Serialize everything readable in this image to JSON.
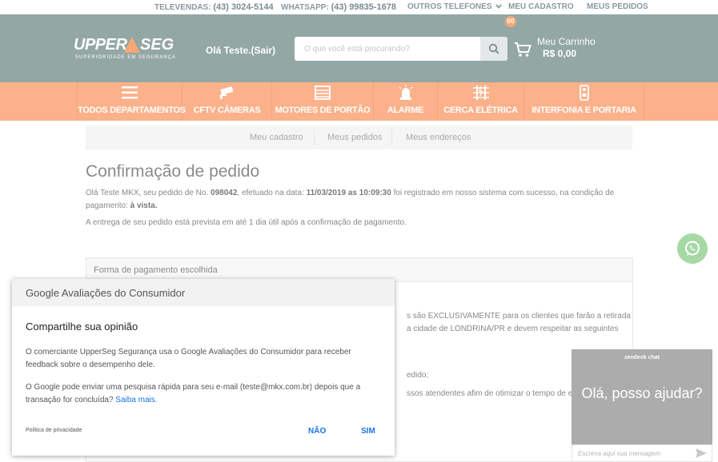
{
  "topbar": {
    "televendas_label": "TELEVENDAS:",
    "televendas_number": "(43) 3024-5144",
    "whatsapp_label": "WHATSAPP:",
    "whatsapp_number": "(43) 99835-1678",
    "outros_telefones": "OUTROS TELEFONES",
    "meu_cadastro": "MEU CADASTRO",
    "meus_pedidos": "MEUS PEDIDOS"
  },
  "header": {
    "logo_text_1": "UPPER",
    "logo_text_2": "SEG",
    "logo_subtitle": "SUPERIORIDADE EM SEGURANÇA",
    "greeting": "Olá Teste.(Sair)",
    "search_placeholder": "O que você está procurando?",
    "cart_title": "Meu Carrinho",
    "cart_value": "R$ 0,00",
    "cart_count": "00"
  },
  "nav": {
    "items": [
      {
        "label": "TODOS DEPARTAMENTOS",
        "icon": "menu-icon"
      },
      {
        "label": "CFTV CÂMERAS",
        "icon": "camera-icon"
      },
      {
        "label": "MOTORES DE PORTÃO",
        "icon": "gate-icon"
      },
      {
        "label": "ALARME",
        "icon": "alarm-icon"
      },
      {
        "label": "CERCA ELÉTRICA",
        "icon": "fence-icon"
      },
      {
        "label": "INTERFONIA E PORTARIA",
        "icon": "intercom-icon"
      }
    ]
  },
  "subnav": {
    "tabs": [
      "Meu cadastro",
      "Meus pedidos",
      "Meus endereços"
    ]
  },
  "order": {
    "title": "Confirmação de pedido",
    "line1_a": "Olá Teste MKX, seu pedido de No. ",
    "order_number": "098042",
    "line1_b": ", efetuado na data: ",
    "order_datetime": "11/03/2019 as 10:09:30",
    "line1_c": " foi registrado em nosso sistema com sucesso, na condição de",
    "line2_a": "pagamento: ",
    "payment_condition": "à vista.",
    "delivery": "A entrega de seu pedido está prevista em até 1 dia útil após a confirmação de pagamento.",
    "payment_box_title": "Forma de pagamento escolhida",
    "partial_1": "s são EXCLUSIVAMENTE para os clientes que farão a retirada",
    "partial_2": "a cidade de LONDRINA/PR e devem respeitar as seguintes",
    "partial_3": "edido;",
    "partial_4": "ssos atendentes afim de otimizar o tempo de entre"
  },
  "google_dialog": {
    "header": "Google Avaliações do Consumidor",
    "title": "Compartilhe sua opinião",
    "text1": "O comerciante UpperSeg Segurança usa o Google Avaliações do Consumidor para receber feedback sobre o desempenho dele.",
    "text2": "O Google pode enviar uma pesquisa rápida para seu e-mail (teste@mkx.com.br) depois que a transação for concluída? ",
    "learn_more": "Saiba mais.",
    "privacy": "Política de privacidade",
    "no": "NÃO",
    "yes": "SIM"
  },
  "chat": {
    "title": "zendesk chat",
    "greeting": "Olá, posso ajudar?",
    "placeholder": "Escreva aqui sua mensagem"
  },
  "colors": {
    "header_bg": "#93a7a5",
    "nav_bg": "#fbb18a",
    "accent_orange": "#f7a774",
    "link_blue": "#1a73e8",
    "whatsapp_green": "#a6d9a5",
    "chat_bg": "#acacac"
  }
}
